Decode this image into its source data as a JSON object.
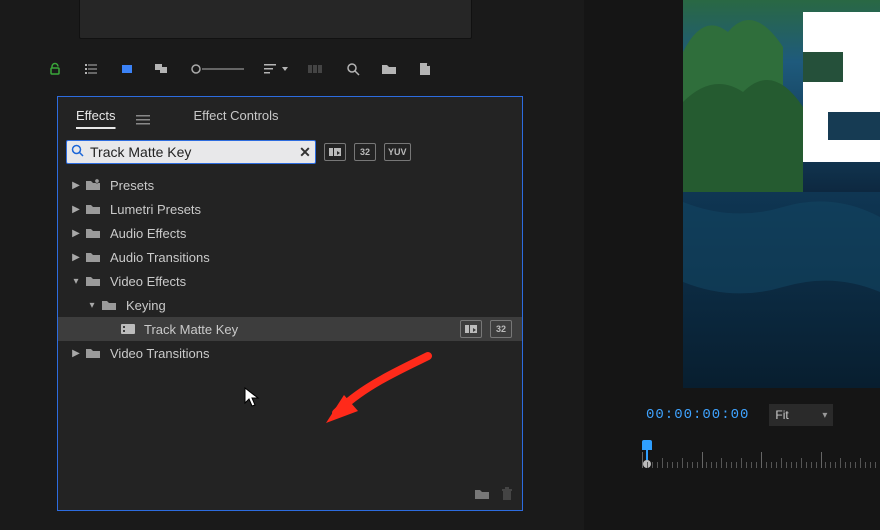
{
  "panel": {
    "tabs": [
      "Effects",
      "Effect Controls"
    ],
    "activeTab": 0
  },
  "search": {
    "value": "Track Matte Key",
    "placeholder": "Search"
  },
  "badges": {
    "preset": "",
    "thirtytwo": "32",
    "yuv": "YUV"
  },
  "tree": [
    {
      "label": "Presets",
      "depth": 0,
      "expanded": false,
      "type": "preset-folder"
    },
    {
      "label": "Lumetri Presets",
      "depth": 0,
      "expanded": false,
      "type": "folder"
    },
    {
      "label": "Audio Effects",
      "depth": 0,
      "expanded": false,
      "type": "folder"
    },
    {
      "label": "Audio Transitions",
      "depth": 0,
      "expanded": false,
      "type": "folder"
    },
    {
      "label": "Video Effects",
      "depth": 0,
      "expanded": true,
      "type": "folder"
    },
    {
      "label": "Keying",
      "depth": 1,
      "expanded": true,
      "type": "folder"
    },
    {
      "label": "Track Matte Key",
      "depth": 2,
      "leaf": true,
      "selected": true,
      "badges": [
        "preset",
        "thirtytwo"
      ]
    },
    {
      "label": "Video Transitions",
      "depth": 0,
      "expanded": false,
      "type": "folder"
    }
  ],
  "monitor": {
    "timecode": "00:00:00:00",
    "zoom": "Fit"
  },
  "colors": {
    "accent": "#2d6cdf",
    "annotation": "#ff2a1a",
    "timecode": "#3fa3ff"
  }
}
